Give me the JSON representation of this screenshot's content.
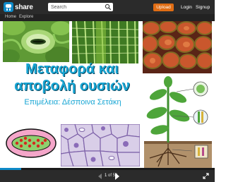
{
  "header": {
    "logo_slide": "slide",
    "logo_share": "share",
    "search_placeholder": "Search",
    "upload_label": "Upload",
    "login_label": "Login",
    "signup_label": "Signup"
  },
  "nav": {
    "home_label": "Home",
    "explore_label": "Explore"
  },
  "slide": {
    "title_line1": "Μεταφορά και",
    "title_line2": "αποβολή ουσιών",
    "author": "Επιμέλεια: Δέσποινα Σετάκη"
  },
  "player": {
    "current_page": "1",
    "page_of": "of 50",
    "progress_fraction": 0.1
  },
  "colors": {
    "brand_blue": "#0e8ac8",
    "upload_orange": "#e06d14",
    "title_cyan": "#18a6d4"
  },
  "icons": {
    "search": "search-icon",
    "prev": "chevron-left-icon",
    "next": "play-next-icon",
    "fullscreen": "fullscreen-icon"
  }
}
